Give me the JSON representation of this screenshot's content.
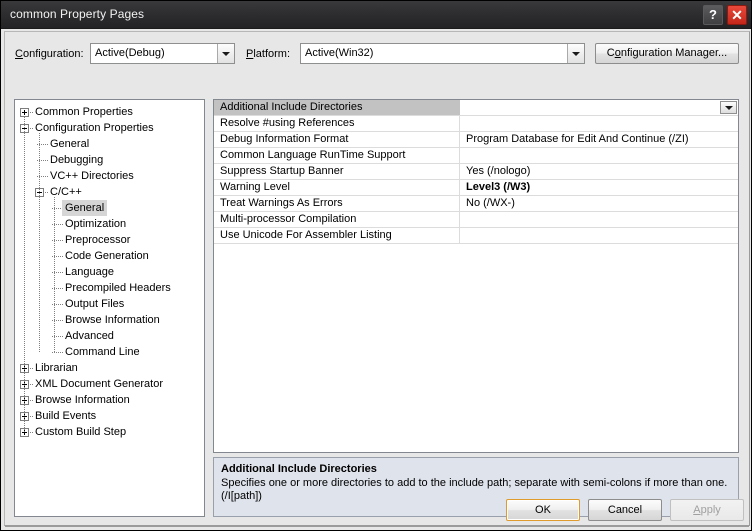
{
  "window": {
    "title": "common Property Pages",
    "help_button": "?",
    "close_button": "✕"
  },
  "toolbar": {
    "configuration_label": "Configuration:",
    "configuration_accel": "C",
    "configuration_value": "Active(Debug)",
    "platform_label": "Platform:",
    "platform_accel": "P",
    "platform_value": "Active(Win32)",
    "config_manager_label_pre": "C",
    "config_manager_accel": "o",
    "config_manager_label_post": "nfiguration Manager..."
  },
  "tree": {
    "nodes": [
      {
        "label": "Common Properties",
        "depth": 0,
        "expander": "plus",
        "selected": false
      },
      {
        "label": "Configuration Properties",
        "depth": 0,
        "expander": "minus",
        "selected": false
      },
      {
        "label": "General",
        "depth": 1,
        "expander": "none",
        "selected": false
      },
      {
        "label": "Debugging",
        "depth": 1,
        "expander": "none",
        "selected": false
      },
      {
        "label": "VC++ Directories",
        "depth": 1,
        "expander": "none",
        "selected": false
      },
      {
        "label": "C/C++",
        "depth": 1,
        "expander": "minus",
        "selected": false
      },
      {
        "label": "General",
        "depth": 2,
        "expander": "none",
        "selected": true
      },
      {
        "label": "Optimization",
        "depth": 2,
        "expander": "none",
        "selected": false
      },
      {
        "label": "Preprocessor",
        "depth": 2,
        "expander": "none",
        "selected": false
      },
      {
        "label": "Code Generation",
        "depth": 2,
        "expander": "none",
        "selected": false
      },
      {
        "label": "Language",
        "depth": 2,
        "expander": "none",
        "selected": false
      },
      {
        "label": "Precompiled Headers",
        "depth": 2,
        "expander": "none",
        "selected": false
      },
      {
        "label": "Output Files",
        "depth": 2,
        "expander": "none",
        "selected": false
      },
      {
        "label": "Browse Information",
        "depth": 2,
        "expander": "none",
        "selected": false
      },
      {
        "label": "Advanced",
        "depth": 2,
        "expander": "none",
        "selected": false
      },
      {
        "label": "Command Line",
        "depth": 2,
        "expander": "none",
        "selected": false
      },
      {
        "label": "Librarian",
        "depth": 0,
        "expander": "plus",
        "selected": false
      },
      {
        "label": "XML Document Generator",
        "depth": 0,
        "expander": "plus",
        "selected": false
      },
      {
        "label": "Browse Information",
        "depth": 0,
        "expander": "plus",
        "selected": false
      },
      {
        "label": "Build Events",
        "depth": 0,
        "expander": "plus",
        "selected": false
      },
      {
        "label": "Custom Build Step",
        "depth": 0,
        "expander": "plus",
        "selected": false
      }
    ]
  },
  "grid": {
    "rows": [
      {
        "name": "Additional Include Directories",
        "value": "",
        "selected": true,
        "modified": false,
        "has_dropdown": true
      },
      {
        "name": "Resolve #using References",
        "value": "",
        "selected": false,
        "modified": false,
        "has_dropdown": false
      },
      {
        "name": "Debug Information Format",
        "value": "Program Database for Edit And Continue (/ZI)",
        "selected": false,
        "modified": false,
        "has_dropdown": false
      },
      {
        "name": "Common Language RunTime Support",
        "value": "",
        "selected": false,
        "modified": false,
        "has_dropdown": false
      },
      {
        "name": "Suppress Startup Banner",
        "value": "Yes (/nologo)",
        "selected": false,
        "modified": false,
        "has_dropdown": false
      },
      {
        "name": "Warning Level",
        "value": "Level3 (/W3)",
        "selected": false,
        "modified": true,
        "has_dropdown": false
      },
      {
        "name": "Treat Warnings As Errors",
        "value": "No (/WX-)",
        "selected": false,
        "modified": false,
        "has_dropdown": false
      },
      {
        "name": "Multi-processor Compilation",
        "value": "",
        "selected": false,
        "modified": false,
        "has_dropdown": false
      },
      {
        "name": "Use Unicode For Assembler Listing",
        "value": "",
        "selected": false,
        "modified": false,
        "has_dropdown": false
      }
    ]
  },
  "description": {
    "title": "Additional Include Directories",
    "body": "Specifies one or more directories to add to the include path; separate with semi-colons if more than one. (/I[path])"
  },
  "footer": {
    "ok_label": "OK",
    "cancel_label": "Cancel",
    "apply_label_pre": "",
    "apply_accel": "A",
    "apply_label_post": "pply",
    "apply_disabled": true
  },
  "colors": {
    "titlebar": "#2e2e30",
    "close_button": "#d32f1f",
    "dialog_bg": "#e7e7e7",
    "selected_row": "#c2c2c2",
    "description_bg": "#dfe3ec",
    "default_button_focus": "#e09b2e"
  }
}
